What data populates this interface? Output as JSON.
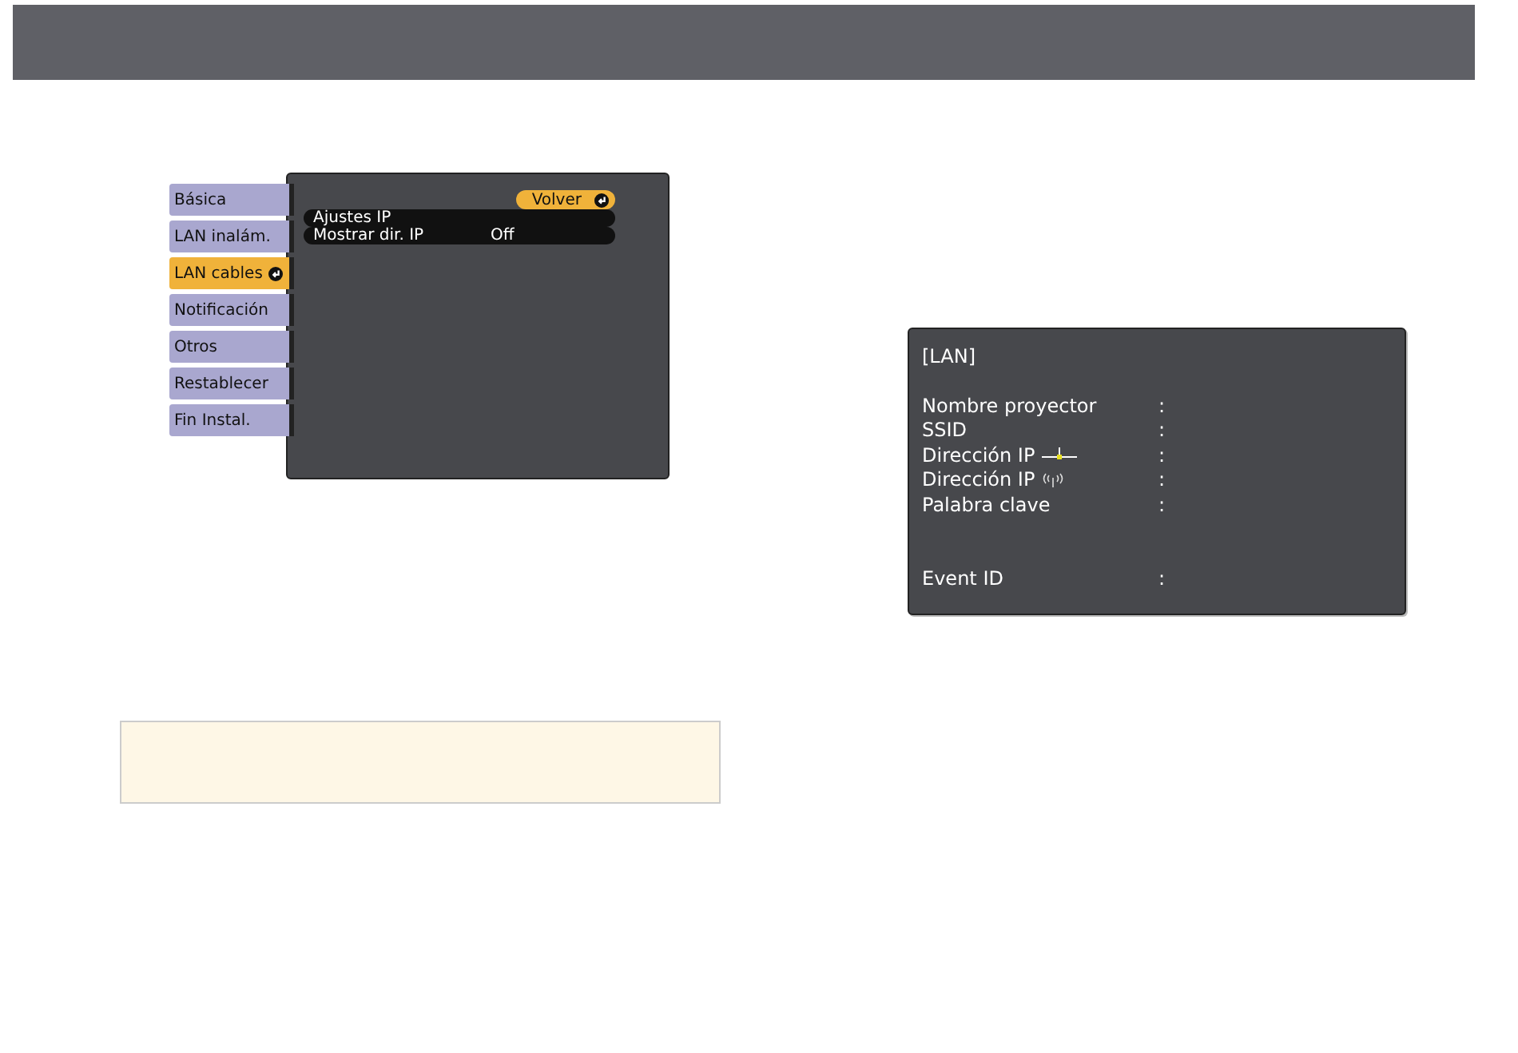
{
  "menu": {
    "tabs": [
      {
        "label": "Básica",
        "selected": false
      },
      {
        "label": "LAN inalám.",
        "selected": false
      },
      {
        "label": "LAN cables",
        "selected": true
      },
      {
        "label": "Notificación",
        "selected": false
      },
      {
        "label": "Otros",
        "selected": false
      },
      {
        "label": "Restablecer",
        "selected": false
      },
      {
        "label": "Fin Instal.",
        "selected": false
      }
    ],
    "back_button": "Volver",
    "items": [
      {
        "label": "Ajustes IP"
      },
      {
        "label": "Mostrar dir. IP",
        "value": "Off"
      }
    ]
  },
  "info_screen": {
    "title": "[LAN]",
    "rows": [
      {
        "label": "Nombre proyector",
        "separator": ":"
      },
      {
        "label": "SSID",
        "separator": ":"
      },
      {
        "label": "Dirección IP",
        "kind": "wired",
        "separator": ":"
      },
      {
        "label": "Dirección IP",
        "kind": "wireless",
        "separator": ":"
      },
      {
        "label": "Palabra clave",
        "separator": ":"
      },
      {
        "kind": "gap"
      },
      {
        "label": "Event ID",
        "separator": ":"
      }
    ]
  },
  "note": {
    "kind": "empty"
  }
}
